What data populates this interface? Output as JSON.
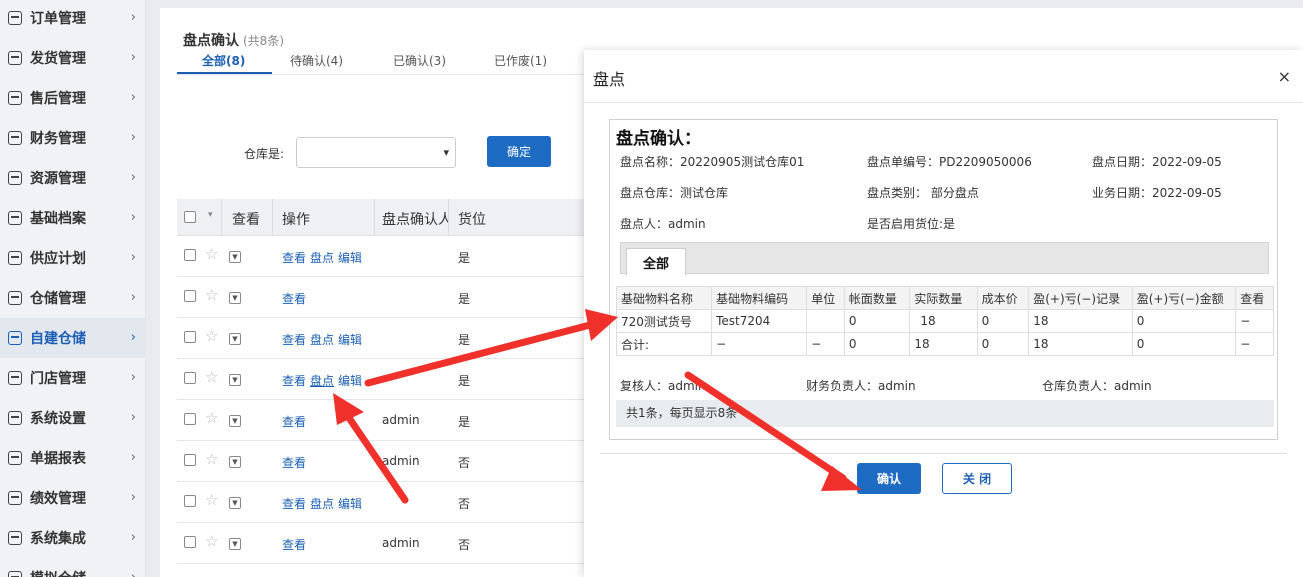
{
  "sidebar": {
    "items": [
      {
        "label": "订单管理",
        "icon": "order-icon"
      },
      {
        "label": "发货管理",
        "icon": "truck-icon"
      },
      {
        "label": "售后管理",
        "icon": "service-icon"
      },
      {
        "label": "财务管理",
        "icon": "finance-icon"
      },
      {
        "label": "资源管理",
        "icon": "resource-icon"
      },
      {
        "label": "基础档案",
        "icon": "archive-icon"
      },
      {
        "label": "供应计划",
        "icon": "plan-icon"
      },
      {
        "label": "仓储管理",
        "icon": "warehouse-icon"
      },
      {
        "label": "自建仓储",
        "icon": "self-warehouse-icon",
        "active": true
      },
      {
        "label": "门店管理",
        "icon": "store-icon"
      },
      {
        "label": "系统设置",
        "icon": "settings-icon"
      },
      {
        "label": "单据报表",
        "icon": "report-icon"
      },
      {
        "label": "绩效管理",
        "icon": "performance-icon"
      },
      {
        "label": "系统集成",
        "icon": "integration-icon"
      },
      {
        "label": "模拟仓储",
        "icon": "simulate-icon"
      }
    ],
    "chevron": "›"
  },
  "page": {
    "title": "盘点确认",
    "count": "(共8条)",
    "tabs": [
      "全部(8)",
      "待确认(4)",
      "已确认(3)",
      "已作废(1)"
    ],
    "filter_label": "仓库是:",
    "confirm_label": "确定",
    "columns": [
      "查看",
      "操作",
      "盘点确认人",
      "货位"
    ],
    "rows": [
      {
        "ops": [
          "查看",
          "盘点",
          "编辑"
        ],
        "user": "",
        "loc": "是"
      },
      {
        "ops": [
          "查看"
        ],
        "user": "",
        "loc": "是"
      },
      {
        "ops": [
          "查看",
          "盘点",
          "编辑"
        ],
        "user": "",
        "loc": "是"
      },
      {
        "ops": [
          "查看",
          "盘点",
          "编辑"
        ],
        "user": "",
        "loc": "是"
      },
      {
        "ops": [
          "查看"
        ],
        "user": "admin",
        "loc": "是"
      },
      {
        "ops": [
          "查看"
        ],
        "user": "admin",
        "loc": "否"
      },
      {
        "ops": [
          "查看",
          "盘点",
          "编辑"
        ],
        "user": "",
        "loc": "否"
      },
      {
        "ops": [
          "查看"
        ],
        "user": "admin",
        "loc": "否"
      }
    ]
  },
  "dialog": {
    "title": "盘点",
    "close": "×",
    "doc_title": "盘点确认：",
    "fields": {
      "name": "盘点名称：20220905测试仓库01",
      "no": "盘点单编号：PD2209050006",
      "date": "盘点日期：2022-09-05",
      "warehouse": "盘点仓库：测试仓库",
      "type": "盘点类别：  部分盘点",
      "biz_date": "业务日期：2022-09-05",
      "person": "盘点人：admin",
      "location": "是否启用货位:是"
    },
    "tab_all": "全部",
    "table": {
      "headers": [
        "基础物料名称",
        "基础物料编码",
        "单位",
        "帐面数量",
        "实际数量",
        "成本价",
        "盈(+)亏(−)记录",
        "盈(+)亏(−)金额",
        "查看"
      ],
      "rows": [
        [
          "720测试货号",
          "Test7204",
          "",
          "0",
          "18",
          "0",
          "18",
          "0",
          "−"
        ],
        [
          "合计:",
          "−",
          "−",
          "0",
          "18",
          "0",
          "18",
          "0",
          "−"
        ]
      ]
    },
    "sign": {
      "reviewer": "复核人：admin",
      "finance": "财务负责人：admin",
      "warehouse": "仓库负责人：admin"
    },
    "pager": "共1条，每页显示8条",
    "confirm": "确认",
    "close_btn": "关 闭"
  },
  "colors": {
    "accent": "#1e6bc4",
    "arrow": "#f0302a"
  }
}
